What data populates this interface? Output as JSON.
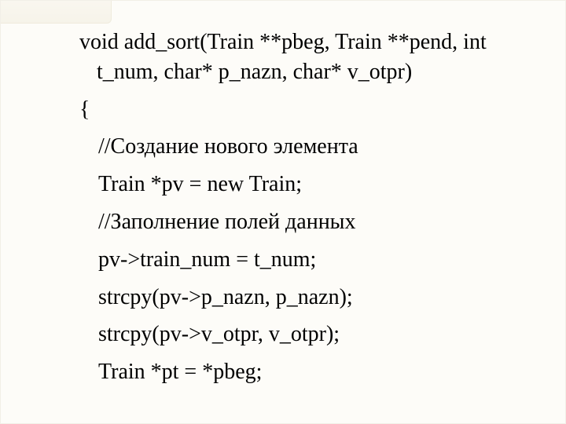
{
  "code": {
    "l1": "void add_sort(Train **pbeg, Train **pend, int t_num, char* p_nazn, char* v_otpr)",
    "l2": "{",
    "l3": "//Создание нового элемента",
    "l4": "Train *pv = new Train;",
    "l5": "//Заполнение полей данных",
    "l6": "pv->train_num = t_num;",
    "l7": "strcpy(pv->p_nazn, p_nazn);",
    "l8": "strcpy(pv->v_otpr, v_otpr);",
    "l9": "Train *pt = *pbeg;"
  }
}
